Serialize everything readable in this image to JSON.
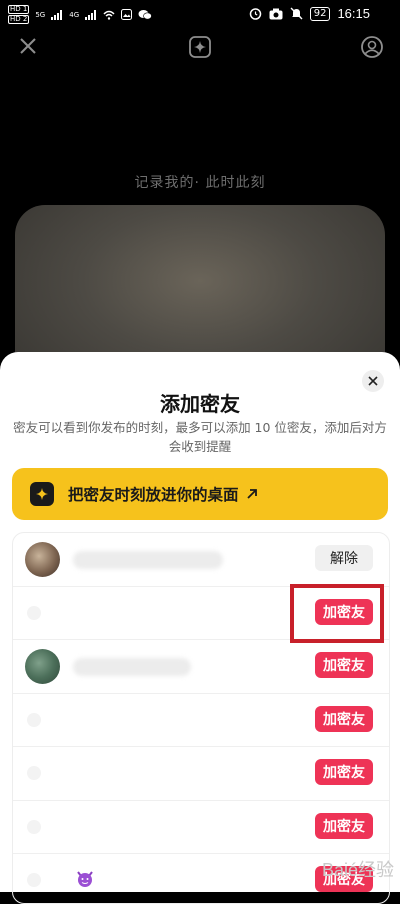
{
  "status_bar": {
    "hd1": "HD 1",
    "hd2": "HD 2",
    "net": "5G",
    "net2": "4G",
    "battery": "92",
    "time": "16:15"
  },
  "top_bar": {
    "close_icon": "close-icon",
    "center_icon": "sparkle-icon",
    "right_icon": "profile-icon"
  },
  "moment": {
    "caption": "记录我的· 此时此刻"
  },
  "sheet": {
    "title": "添加密友",
    "description": "密友可以看到你发布的时刻，最多可以添加 10 位密友，添加后对方会收到提醒",
    "widget_banner_label": "把密友时刻放进你的桌面",
    "friends": [
      {
        "action": "解除"
      },
      {
        "action": "加密友"
      },
      {
        "action": "加密友"
      },
      {
        "action": "加密友"
      },
      {
        "action": "加密友"
      },
      {
        "action": "加密友"
      },
      {
        "action": "加密友"
      }
    ]
  },
  "colors": {
    "add_button": "#ee3356",
    "banner": "#f6c21c",
    "highlight": "#c8202a"
  },
  "watermark": "Baié经验"
}
